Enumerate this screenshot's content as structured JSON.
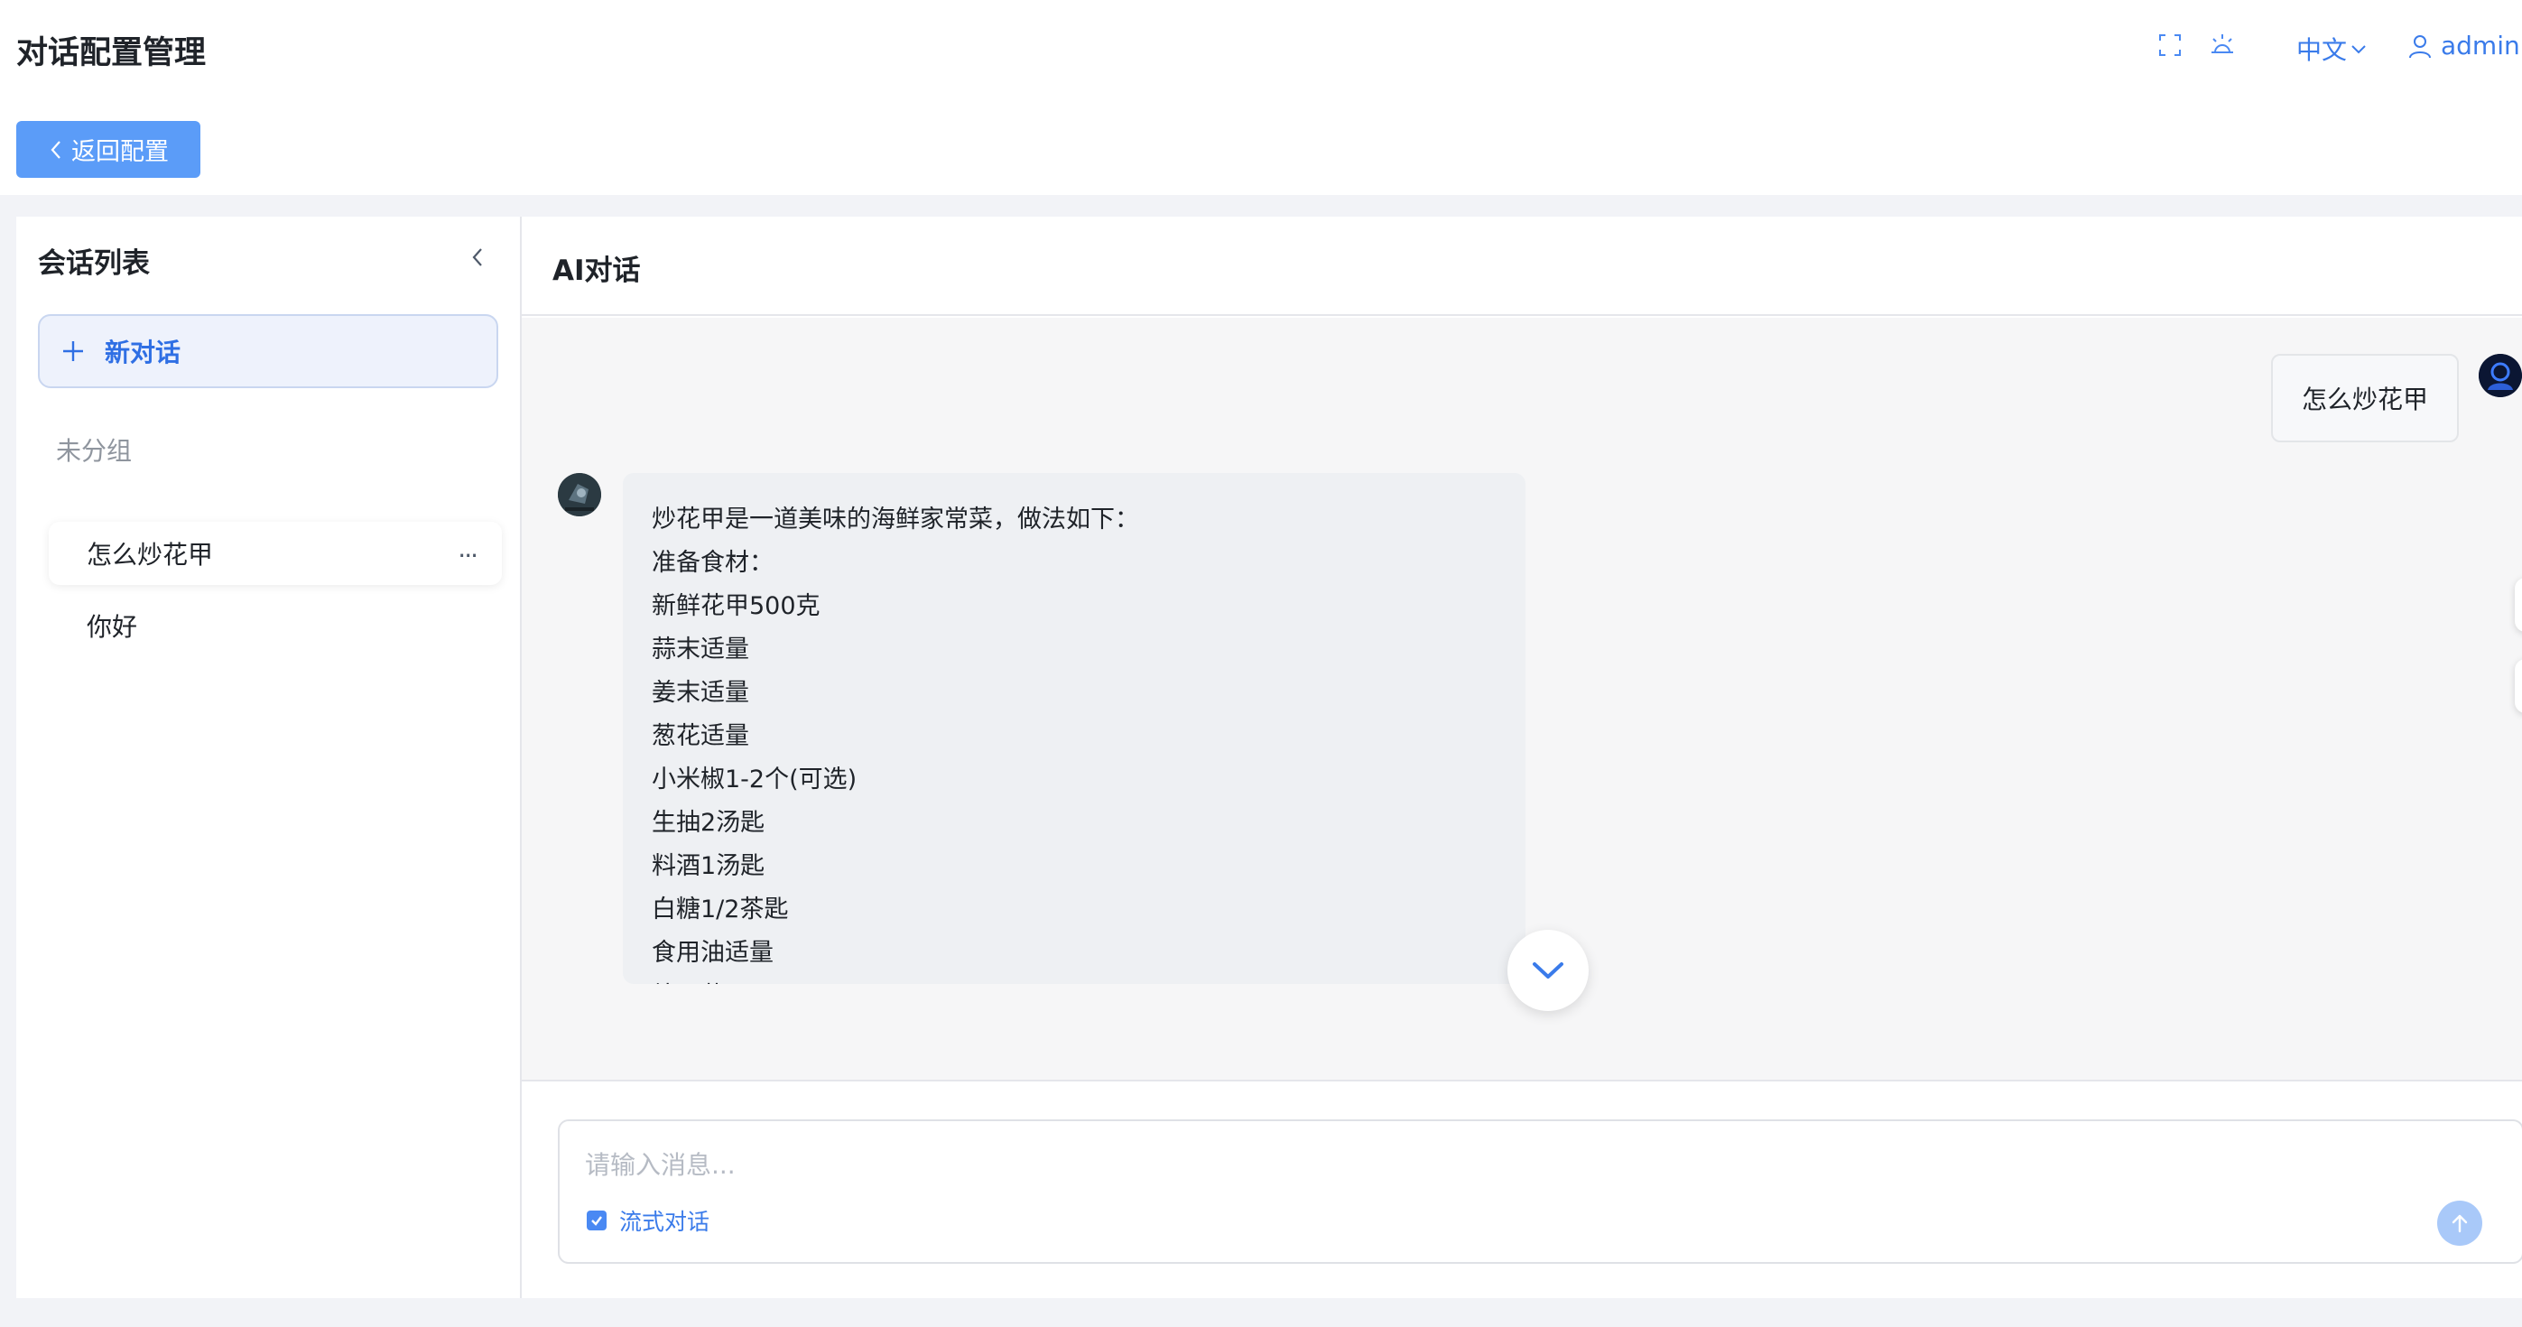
{
  "header": {
    "title": "对话配置管理",
    "back_label": "返回配置",
    "language": "中文",
    "username": "admin",
    "icons": [
      "fullscreen-icon",
      "theme-icon",
      "chevron-down-icon",
      "user-icon"
    ]
  },
  "sidebar": {
    "title": "会话列表",
    "new_chat_label": "新对话",
    "group_label": "未分组",
    "conversations": [
      {
        "title": "怎么炒花甲",
        "active": true
      },
      {
        "title": "你好",
        "active": false
      }
    ],
    "more_label": "..."
  },
  "chat": {
    "title": "AI对话",
    "user_message": "怎么炒花甲",
    "bot_lines": [
      "炒花甲是一道美味的海鲜家常菜，做法如下：",
      "准备食材：",
      "新鲜花甲500克",
      "蒜末适量",
      "姜末适量",
      "葱花适量",
      "小米椒1-2个(可选)",
      "生抽2汤匙",
      "料酒1汤匙",
      "白糖1/2茶匙",
      "食用油适量",
      "处理花甲："
    ],
    "input_placeholder": "请输入消息...",
    "stream_label": "流式对话",
    "stream_checked": true
  },
  "colors": {
    "primary": "#4a89f3",
    "back_button": "#5b9cf8",
    "send_disabled": "#a9c9f9"
  }
}
